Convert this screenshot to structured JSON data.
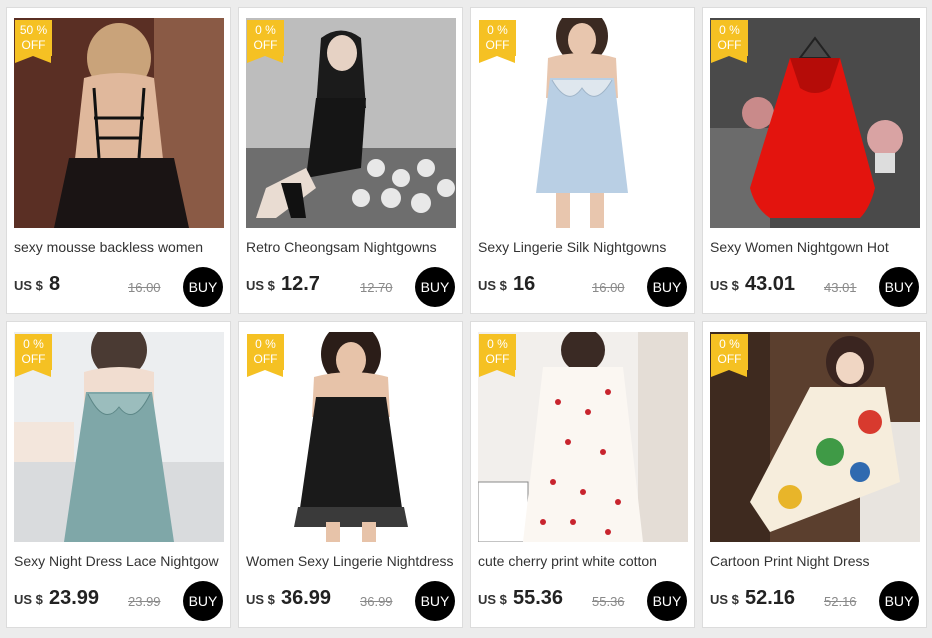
{
  "products": [
    {
      "discount": "50 %",
      "off": "OFF",
      "title": "sexy mousse backless women",
      "currency": "US $",
      "price": "8",
      "old_price": "16.00",
      "buy": "BUY"
    },
    {
      "discount": "0 %",
      "off": "OFF",
      "title": "Retro Cheongsam Nightgowns",
      "currency": "US $",
      "price": "12.7",
      "old_price": "12.70",
      "buy": "BUY"
    },
    {
      "discount": "0 %",
      "off": "OFF",
      "title": "Sexy Lingerie Silk Nightgowns",
      "currency": "US $",
      "price": "16",
      "old_price": "16.00",
      "buy": "BUY"
    },
    {
      "discount": "0 %",
      "off": "OFF",
      "title": "Sexy Women Nightgown Hot",
      "currency": "US $",
      "price": "43.01",
      "old_price": "43.01",
      "buy": "BUY"
    },
    {
      "discount": "0 %",
      "off": "OFF",
      "title": "Sexy Night Dress Lace Nightgow",
      "currency": "US $",
      "price": "23.99",
      "old_price": "23.99",
      "buy": "BUY"
    },
    {
      "discount": "0 %",
      "off": "OFF",
      "title": "Women Sexy Lingerie Nightdress",
      "currency": "US $",
      "price": "36.99",
      "old_price": "36.99",
      "buy": "BUY"
    },
    {
      "discount": "0 %",
      "off": "OFF",
      "title": "cute cherry print white cotton",
      "currency": "US $",
      "price": "55.36",
      "old_price": "55.36",
      "buy": "BUY"
    },
    {
      "discount": "0 %",
      "off": "OFF",
      "title": "Cartoon Print Night Dress",
      "currency": "US $",
      "price": "52.16",
      "old_price": "52.16",
      "buy": "BUY"
    }
  ],
  "colors": {
    "badge": "#f5c123",
    "buy_button": "#000000",
    "background": "#ececec"
  }
}
